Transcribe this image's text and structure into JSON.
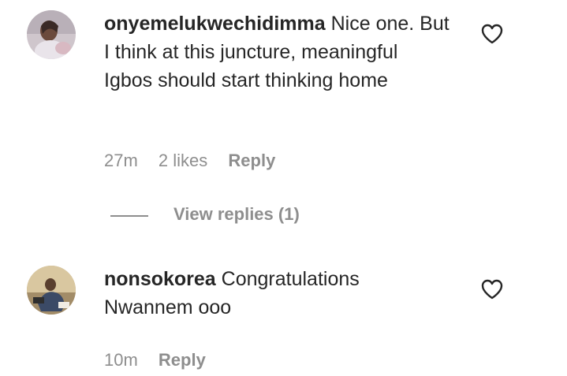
{
  "comments": [
    {
      "username": "onyemelukwechidimma",
      "text": "Nice one. But I think at this juncture, meaningful Igbos should start thinking home",
      "time": "27m",
      "likes": "2 likes",
      "reply_label": "Reply",
      "avatar_icon": "profile-photo",
      "like_icon": "heart-outline-icon"
    },
    {
      "username": "nonsokorea",
      "text": "Congratulations Nwannem ooo",
      "time": "10m",
      "reply_label": "Reply",
      "avatar_icon": "profile-photo",
      "like_icon": "heart-outline-icon"
    }
  ],
  "view_replies": {
    "label": "View replies (1)"
  },
  "colors": {
    "text": "#262626",
    "secondary": "#8e8e8e",
    "background": "#ffffff"
  }
}
